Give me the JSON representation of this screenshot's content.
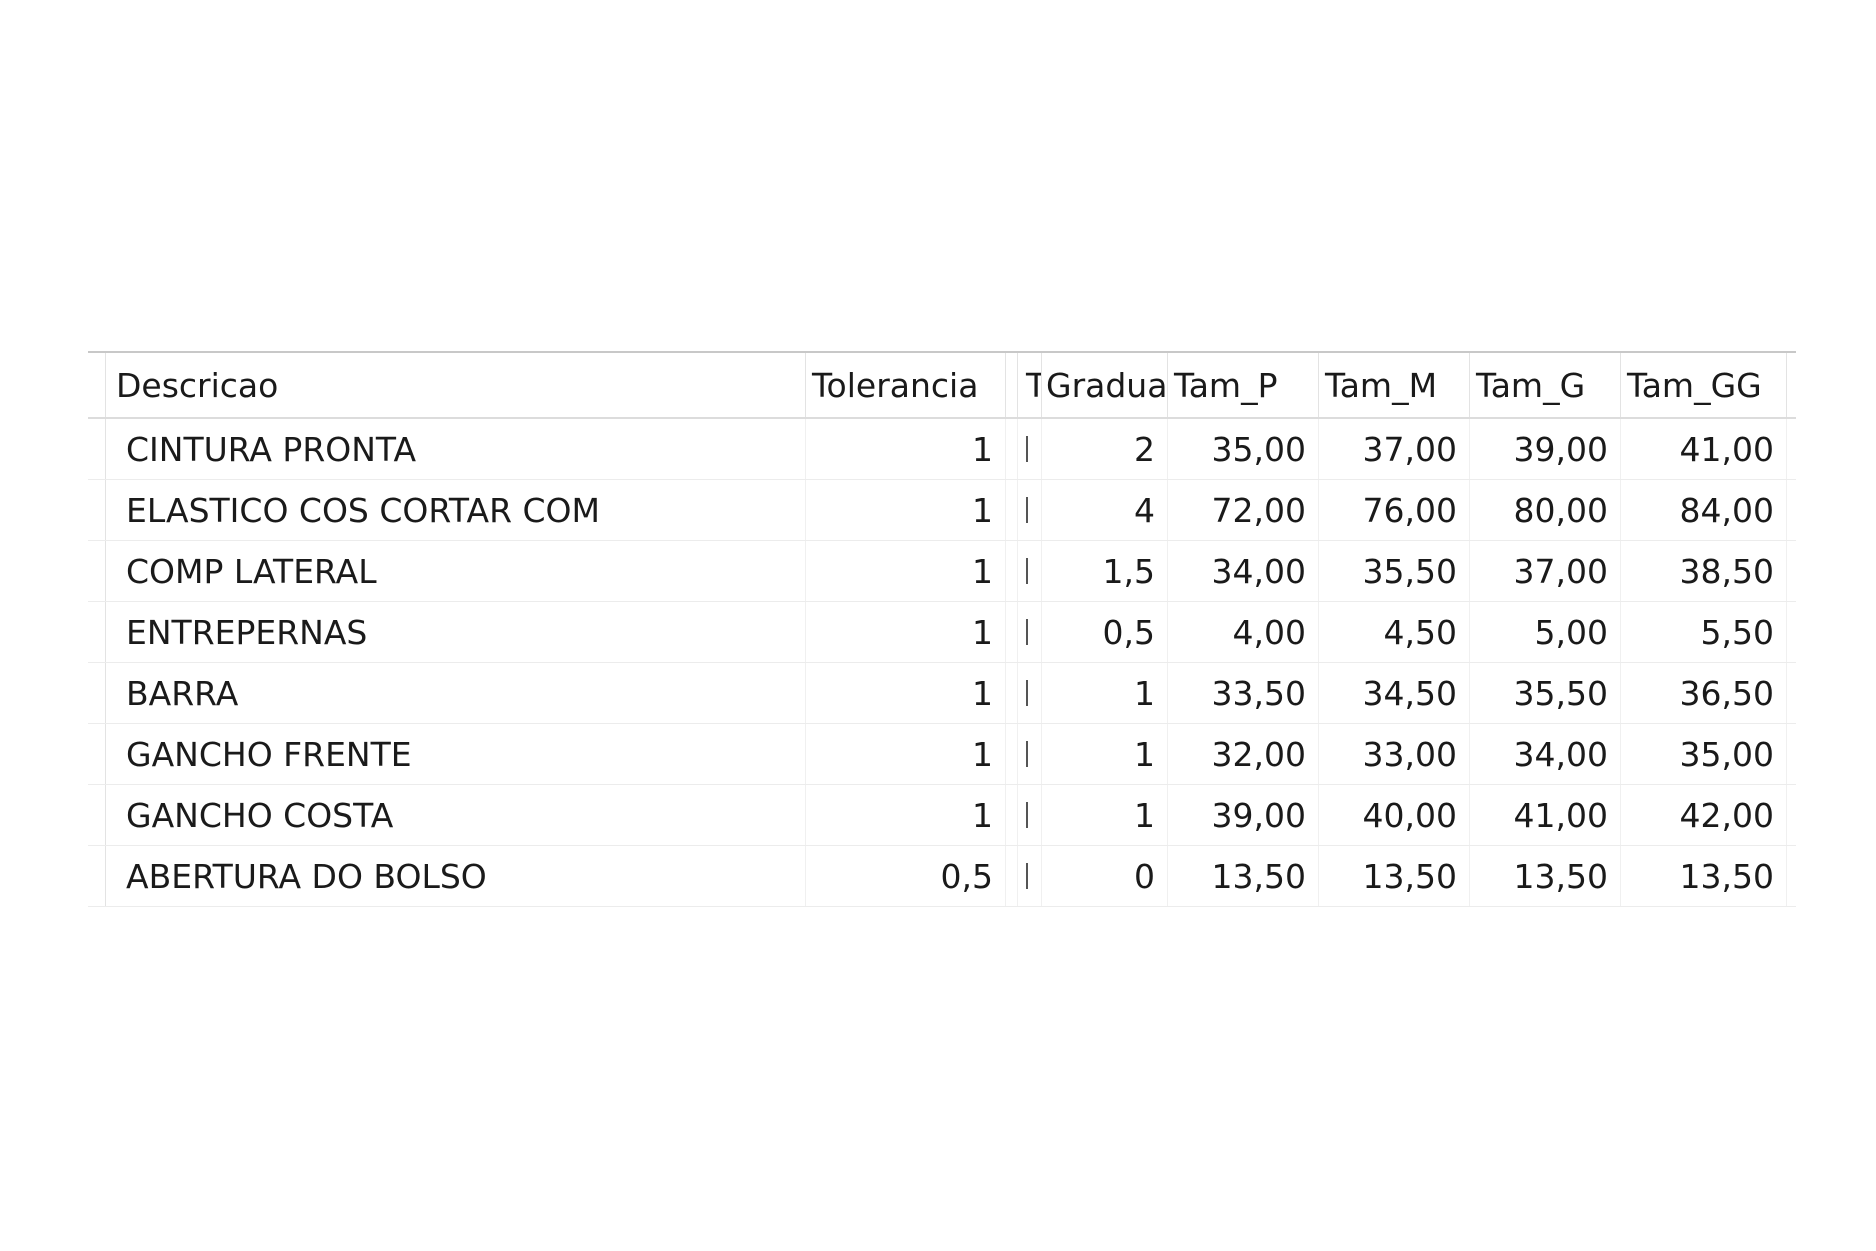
{
  "grid": {
    "columns": [
      "Descricao",
      "Tolerancia",
      "",
      "T",
      "Gradua",
      "Tam_P",
      "Tam_M",
      "Tam_G",
      "Tam_GG"
    ],
    "rows": [
      {
        "descricao": "CINTURA PRONTA",
        "tolerancia": "1",
        "gradua": "2",
        "tam_p": "35,00",
        "tam_m": "37,00",
        "tam_g": "39,00",
        "tam_gg": "41,00"
      },
      {
        "descricao": "ELASTICO COS CORTAR COM",
        "tolerancia": "1",
        "gradua": "4",
        "tam_p": "72,00",
        "tam_m": "76,00",
        "tam_g": "80,00",
        "tam_gg": "84,00"
      },
      {
        "descricao": "COMP LATERAL",
        "tolerancia": "1",
        "gradua": "1,5",
        "tam_p": "34,00",
        "tam_m": "35,50",
        "tam_g": "37,00",
        "tam_gg": "38,50"
      },
      {
        "descricao": "ENTREPERNAS",
        "tolerancia": "1",
        "gradua": "0,5",
        "tam_p": "4,00",
        "tam_m": "4,50",
        "tam_g": "5,00",
        "tam_gg": "5,50"
      },
      {
        "descricao": "BARRA",
        "tolerancia": "1",
        "gradua": "1",
        "tam_p": "33,50",
        "tam_m": "34,50",
        "tam_g": "35,50",
        "tam_gg": "36,50"
      },
      {
        "descricao": "GANCHO FRENTE",
        "tolerancia": "1",
        "gradua": "1",
        "tam_p": "32,00",
        "tam_m": "33,00",
        "tam_g": "34,00",
        "tam_gg": "35,00"
      },
      {
        "descricao": "GANCHO COSTA",
        "tolerancia": "1",
        "gradua": "1",
        "tam_p": "39,00",
        "tam_m": "40,00",
        "tam_g": "41,00",
        "tam_gg": "42,00"
      },
      {
        "descricao": "ABERTURA DO BOLSO",
        "tolerancia": "0,5",
        "gradua": "0",
        "tam_p": "13,50",
        "tam_m": "13,50",
        "tam_g": "13,50",
        "tam_gg": "13,50"
      }
    ]
  }
}
